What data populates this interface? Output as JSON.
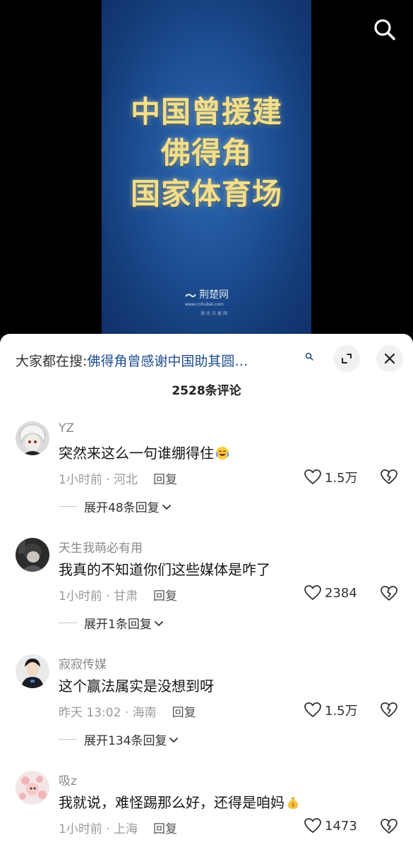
{
  "video": {
    "title_lines": [
      "中国曾援建",
      "佛得角",
      "国家体育场"
    ],
    "watermark_main": "荆楚网",
    "watermark_sub": "www.cnhubei.com",
    "watermark_sub2": "湖北日报网"
  },
  "panel": {
    "search_prefix": "大家都在搜:",
    "search_hot": "佛得角曾感谢中国助其圆…",
    "comment_count": "2528条评论"
  },
  "comments": [
    {
      "username": "YZ",
      "text": "突然来这么一句谁绷得住",
      "emoji": "laugh-cry",
      "time_location": "1小时前 · 河北",
      "reply_label": "回复",
      "likes": "1.5万",
      "expand_label": "展开48条回复"
    },
    {
      "username": "天生我萌必有用",
      "text": "我真的不知道你们这些媒体是咋了",
      "time_location": "1小时前 · 甘肃",
      "reply_label": "回复",
      "likes": "2384",
      "expand_label": "展开1条回复"
    },
    {
      "username": "寂寂传媒",
      "text": "这个赢法属实是没想到呀",
      "time_location": "昨天 13:02 · 海南",
      "reply_label": "回复",
      "likes": "1.5万",
      "expand_label": "展开134条回复"
    },
    {
      "username": "吸z",
      "text": "我就说，难怪踢那么好，还得是咱妈",
      "emoji": "money-bag",
      "time_location": "1小时前 · 上海",
      "reply_label": "回复",
      "likes": "1473"
    }
  ],
  "icons": {
    "search": "search-icon",
    "expand": "expand-icon",
    "close": "close-icon",
    "like": "heart-icon",
    "dislike": "broken-heart-icon",
    "chevron": "chevron-down-icon"
  },
  "colors": {
    "hot_search": "#1f4e8f",
    "video_bg": "#1d4f94",
    "title_gold": "#f3df8a"
  }
}
